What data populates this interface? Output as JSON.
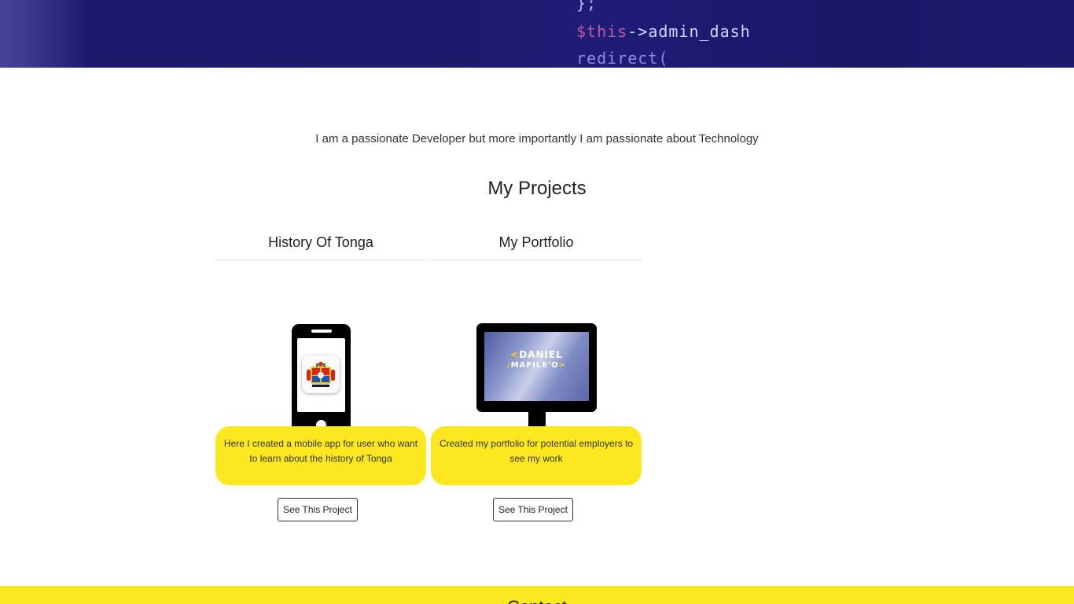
{
  "hero": {
    "code_lines": [
      {
        "text": "};"
      },
      {
        "prefix": "$this",
        "arrow": "->",
        "text": "admin_dash"
      },
      {
        "text": "redirect("
      }
    ]
  },
  "intro": {
    "tagline": "I am a passionate Developer but more importantly I am passionate about Technology"
  },
  "projects": {
    "heading": "My Projects",
    "items": [
      {
        "title": "History Of Tonga",
        "device": "phone",
        "description": "Here I created a mobile app for user who want to learn about the history of Tonga",
        "button_label": "See This Project"
      },
      {
        "title": "My Portfolio",
        "device": "monitor",
        "screen_logo_line1_bracket": "<",
        "screen_logo_line1": "DANIEL",
        "screen_logo_line2_bracket": "/",
        "screen_logo_line2": "MAFILE'O",
        "screen_logo_line2_end": ">",
        "description": "Created my portfolio for potential employers to see my work",
        "button_label": "See This Project"
      }
    ]
  },
  "footer": {
    "title": "Contact"
  },
  "colors": {
    "accent_yellow": "#fde81f",
    "hero_navy": "#1c1a6a"
  }
}
